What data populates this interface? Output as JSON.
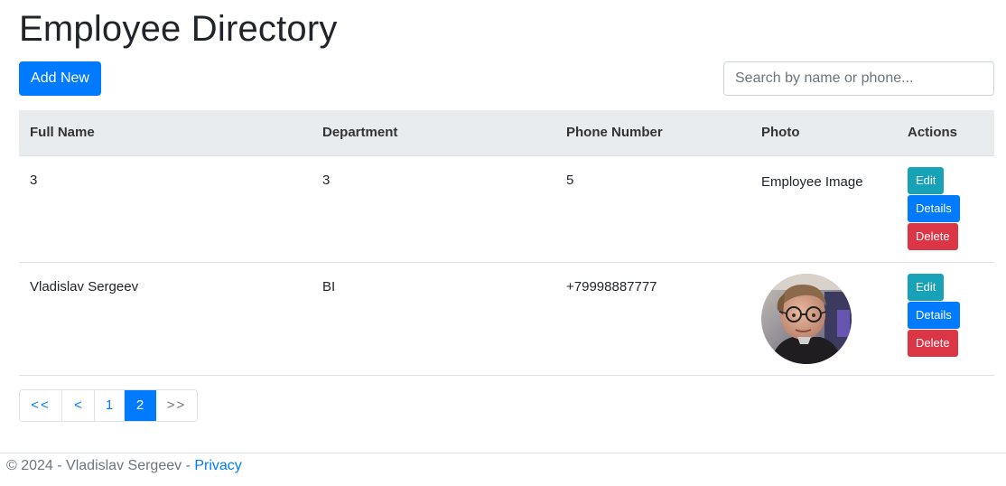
{
  "page": {
    "title": "Employee Directory"
  },
  "toolbar": {
    "add_label": "Add New",
    "search_placeholder": "Search by name or phone...",
    "search_value": ""
  },
  "table": {
    "headers": {
      "name": "Full Name",
      "department": "Department",
      "phone": "Phone Number",
      "photo": "Photo",
      "actions": "Actions"
    },
    "rows": [
      {
        "name": "3",
        "department": "3",
        "phone": "5",
        "photo_text": "Employee Image"
      },
      {
        "name": "Vladislav Sergeev",
        "department": "BI",
        "phone": "+79998887777",
        "photo_text": ""
      }
    ],
    "actions": {
      "edit": "Edit",
      "details": "Details",
      "delete": "Delete"
    }
  },
  "pagination": {
    "first": "<<",
    "prev": "<",
    "pages": [
      "1",
      "2"
    ],
    "current": "2",
    "last": ">>"
  },
  "footer": {
    "copyright": "© 2024 - Vladislav Sergeev -",
    "privacy_link": "Privacy"
  },
  "colors": {
    "primary": "#007bff",
    "info": "#17a2b8",
    "danger": "#dc3545",
    "header_bg": "#e9ecef"
  }
}
